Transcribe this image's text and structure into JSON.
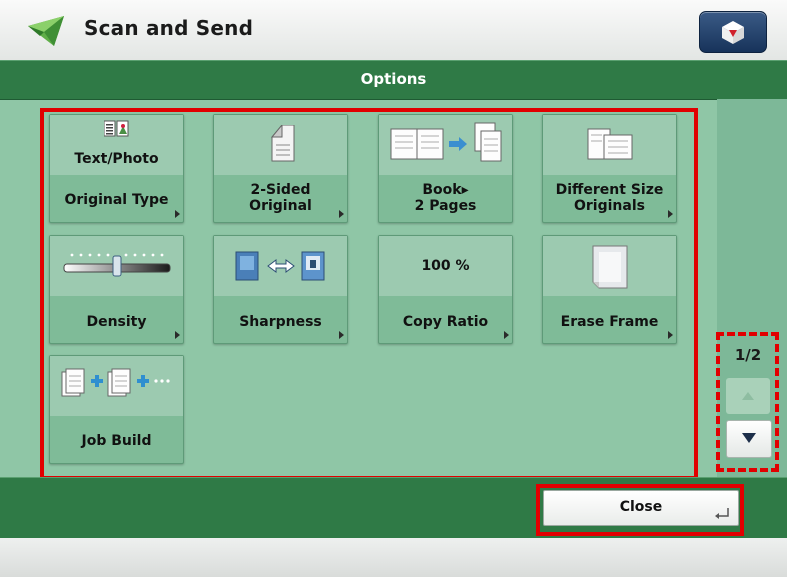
{
  "header": {
    "title": "Scan and Send",
    "app_icon": "scan-send-icon",
    "home_icon": "home-icon"
  },
  "options_bar": {
    "title": "Options"
  },
  "tiles": [
    {
      "id": "original-type",
      "top_text": "Text/Photo",
      "label_line1": "Original Type",
      "label_line2": ""
    },
    {
      "id": "2-sided-original",
      "label_line1": "2-Sided",
      "label_line2": "Original"
    },
    {
      "id": "book-2-pages",
      "label_line1": "Book▸",
      "label_line2": "2 Pages"
    },
    {
      "id": "different-size-originals",
      "label_line1": "Different Size",
      "label_line2": "Originals"
    },
    {
      "id": "density",
      "label_line1": "Density",
      "label_line2": ""
    },
    {
      "id": "sharpness",
      "label_line1": "Sharpness",
      "label_line2": ""
    },
    {
      "id": "copy-ratio",
      "top_text": "100 %",
      "label_line1": "Copy Ratio",
      "label_line2": ""
    },
    {
      "id": "erase-frame",
      "label_line1": "Erase Frame",
      "label_line2": ""
    },
    {
      "id": "job-build",
      "label_line1": "Job Build",
      "label_line2": ""
    }
  ],
  "pager": {
    "page": "1/2",
    "up_icon": "triangle-up-icon",
    "down_icon": "triangle-down-icon"
  },
  "footer": {
    "close_label": "Close",
    "close_icon": "enter-icon"
  },
  "colors": {
    "accent_green": "#2f7a46",
    "panel_green": "#8fc6a6",
    "highlight_red": "#e10000"
  }
}
